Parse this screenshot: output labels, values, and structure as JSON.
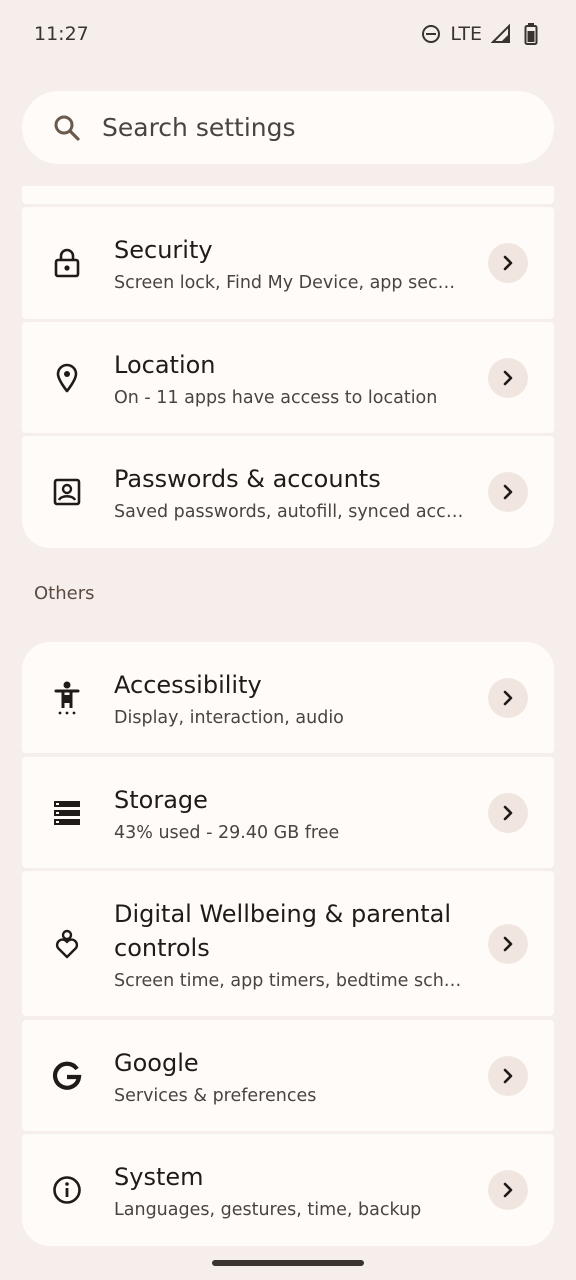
{
  "status_bar": {
    "time": "11:27",
    "network": "LTE",
    "icons": [
      "do-not-disturb-icon",
      "signal-icon",
      "battery-icon"
    ]
  },
  "search": {
    "placeholder": "Search settings",
    "icon": "search-icon"
  },
  "sections": {
    "others_label": "Others"
  },
  "items": [
    {
      "id": "security",
      "icon": "lock-icon",
      "title": "Security",
      "subtitle": "Screen lock, Find My Device, app security"
    },
    {
      "id": "location",
      "icon": "location-pin-icon",
      "title": "Location",
      "subtitle": "On - 11 apps have access to location"
    },
    {
      "id": "passwords",
      "icon": "account-box-icon",
      "title": "Passwords & accounts",
      "subtitle": "Saved passwords, autofill, synced acco..."
    },
    {
      "id": "accessibility",
      "icon": "accessibility-icon",
      "title": "Accessibility",
      "subtitle": "Display, interaction, audio"
    },
    {
      "id": "storage",
      "icon": "storage-icon",
      "title": "Storage",
      "subtitle": "43% used - 29.40 GB free"
    },
    {
      "id": "wellbeing",
      "icon": "wellbeing-icon",
      "title_line1": "Digital Wellbeing & parental",
      "title_line2": "controls",
      "subtitle": "Screen time, app timers, bedtime sched..."
    },
    {
      "id": "google",
      "icon": "google-icon",
      "title": "Google",
      "subtitle": "Services & preferences"
    },
    {
      "id": "system",
      "icon": "info-icon",
      "title": "System",
      "subtitle": "Languages, gestures, time, backup"
    }
  ],
  "colors": {
    "background": "#f5eeea",
    "card": "#fffbf9",
    "chevron_bg": "#f1e6df",
    "text_primary": "#1f1b18",
    "text_secondary": "#4a4440"
  }
}
